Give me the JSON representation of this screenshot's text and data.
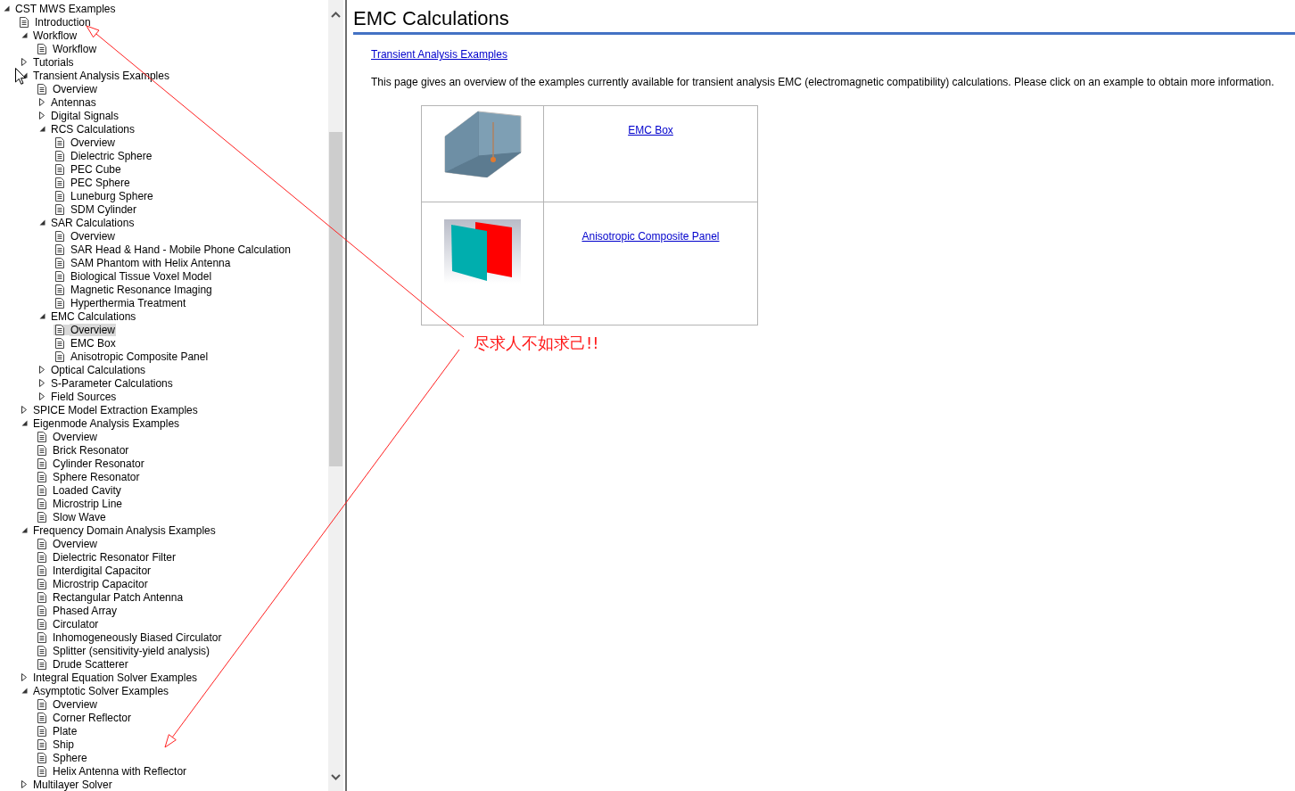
{
  "tree": [
    {
      "label": "CST MWS Examples",
      "kind": "folder",
      "expanded": true,
      "selected": false,
      "children": [
        {
          "label": "Introduction",
          "kind": "page",
          "selected": false
        },
        {
          "label": "Workflow",
          "kind": "folder",
          "expanded": true,
          "selected": false,
          "children": [
            {
              "label": "Workflow",
              "kind": "page",
              "selected": false
            }
          ]
        },
        {
          "label": "Tutorials",
          "kind": "folder",
          "expanded": false,
          "selected": false
        },
        {
          "label": "Transient Analysis Examples",
          "kind": "folder",
          "expanded": true,
          "selected": false,
          "children": [
            {
              "label": "Overview",
              "kind": "page",
              "selected": false
            },
            {
              "label": "Antennas",
              "kind": "folder",
              "expanded": false,
              "selected": false
            },
            {
              "label": "Digital Signals",
              "kind": "folder",
              "expanded": false,
              "selected": false
            },
            {
              "label": "RCS Calculations",
              "kind": "folder",
              "expanded": true,
              "selected": false,
              "children": [
                {
                  "label": "Overview",
                  "kind": "page",
                  "selected": false
                },
                {
                  "label": "Dielectric Sphere",
                  "kind": "page",
                  "selected": false
                },
                {
                  "label": "PEC Cube",
                  "kind": "page",
                  "selected": false
                },
                {
                  "label": "PEC Sphere",
                  "kind": "page",
                  "selected": false
                },
                {
                  "label": "Luneburg Sphere",
                  "kind": "page",
                  "selected": false
                },
                {
                  "label": "SDM Cylinder",
                  "kind": "page",
                  "selected": false
                }
              ]
            },
            {
              "label": "SAR Calculations",
              "kind": "folder",
              "expanded": true,
              "selected": false,
              "children": [
                {
                  "label": "Overview",
                  "kind": "page",
                  "selected": false
                },
                {
                  "label": "SAR Head & Hand - Mobile Phone Calculation",
                  "kind": "page",
                  "selected": false
                },
                {
                  "label": "SAM Phantom with Helix Antenna",
                  "kind": "page",
                  "selected": false
                },
                {
                  "label": "Biological Tissue Voxel Model",
                  "kind": "page",
                  "selected": false
                },
                {
                  "label": "Magnetic Resonance Imaging",
                  "kind": "page",
                  "selected": false
                },
                {
                  "label": "Hyperthermia Treatment",
                  "kind": "page",
                  "selected": false
                }
              ]
            },
            {
              "label": "EMC Calculations",
              "kind": "folder",
              "expanded": true,
              "selected": false,
              "children": [
                {
                  "label": "Overview",
                  "kind": "page",
                  "selected": true
                },
                {
                  "label": "EMC Box",
                  "kind": "page",
                  "selected": false
                },
                {
                  "label": "Anisotropic Composite Panel",
                  "kind": "page",
                  "selected": false
                }
              ]
            },
            {
              "label": "Optical Calculations",
              "kind": "folder",
              "expanded": false,
              "selected": false
            },
            {
              "label": "S-Parameter Calculations",
              "kind": "folder",
              "expanded": false,
              "selected": false
            },
            {
              "label": "Field Sources",
              "kind": "folder",
              "expanded": false,
              "selected": false
            }
          ]
        },
        {
          "label": "SPICE Model Extraction Examples",
          "kind": "folder",
          "expanded": false,
          "selected": false
        },
        {
          "label": "Eigenmode Analysis Examples",
          "kind": "folder",
          "expanded": true,
          "selected": false,
          "children": [
            {
              "label": "Overview",
              "kind": "page",
              "selected": false
            },
            {
              "label": "Brick Resonator",
              "kind": "page",
              "selected": false
            },
            {
              "label": "Cylinder Resonator",
              "kind": "page",
              "selected": false
            },
            {
              "label": "Sphere Resonator",
              "kind": "page",
              "selected": false
            },
            {
              "label": "Loaded Cavity",
              "kind": "page",
              "selected": false
            },
            {
              "label": "Microstrip Line",
              "kind": "page",
              "selected": false
            },
            {
              "label": "Slow Wave",
              "kind": "page",
              "selected": false
            }
          ]
        },
        {
          "label": "Frequency Domain Analysis Examples",
          "kind": "folder",
          "expanded": true,
          "selected": false,
          "children": [
            {
              "label": "Overview",
              "kind": "page",
              "selected": false
            },
            {
              "label": "Dielectric Resonator Filter",
              "kind": "page",
              "selected": false
            },
            {
              "label": "Interdigital Capacitor",
              "kind": "page",
              "selected": false
            },
            {
              "label": "Microstrip Capacitor",
              "kind": "page",
              "selected": false
            },
            {
              "label": "Rectangular Patch Antenna",
              "kind": "page",
              "selected": false
            },
            {
              "label": "Phased Array",
              "kind": "page",
              "selected": false
            },
            {
              "label": "Circulator",
              "kind": "page",
              "selected": false
            },
            {
              "label": "Inhomogeneously Biased Circulator",
              "kind": "page",
              "selected": false
            },
            {
              "label": "Splitter (sensitivity-yield analysis)",
              "kind": "page",
              "selected": false
            },
            {
              "label": "Drude Scatterer",
              "kind": "page",
              "selected": false
            }
          ]
        },
        {
          "label": "Integral Equation Solver Examples",
          "kind": "folder",
          "expanded": false,
          "selected": false
        },
        {
          "label": "Asymptotic Solver Examples",
          "kind": "folder",
          "expanded": true,
          "selected": false,
          "children": [
            {
              "label": "Overview",
              "kind": "page",
              "selected": false
            },
            {
              "label": "Corner Reflector",
              "kind": "page",
              "selected": false
            },
            {
              "label": "Plate",
              "kind": "page",
              "selected": false
            },
            {
              "label": "Ship",
              "kind": "page",
              "selected": false
            },
            {
              "label": "Sphere",
              "kind": "page",
              "selected": false
            },
            {
              "label": "Helix Antenna with Reflector",
              "kind": "page",
              "selected": false
            }
          ]
        },
        {
          "label": "Multilayer Solver",
          "kind": "folder",
          "expanded": false,
          "selected": false
        }
      ]
    }
  ],
  "page": {
    "title": "EMC Calculations",
    "breadcrumb": "Transient Analysis Examples",
    "intro": "This page gives an overview of the examples currently available for transient analysis EMC (electromagnetic compatibility) calculations. Please click on an example to obtain more information.",
    "examples": [
      {
        "kind": "box",
        "link": "EMC Box"
      },
      {
        "kind": "panel",
        "link": "Anisotropic Composite Panel"
      }
    ]
  },
  "annotation": {
    "text": "尽求人不如求己!!"
  }
}
